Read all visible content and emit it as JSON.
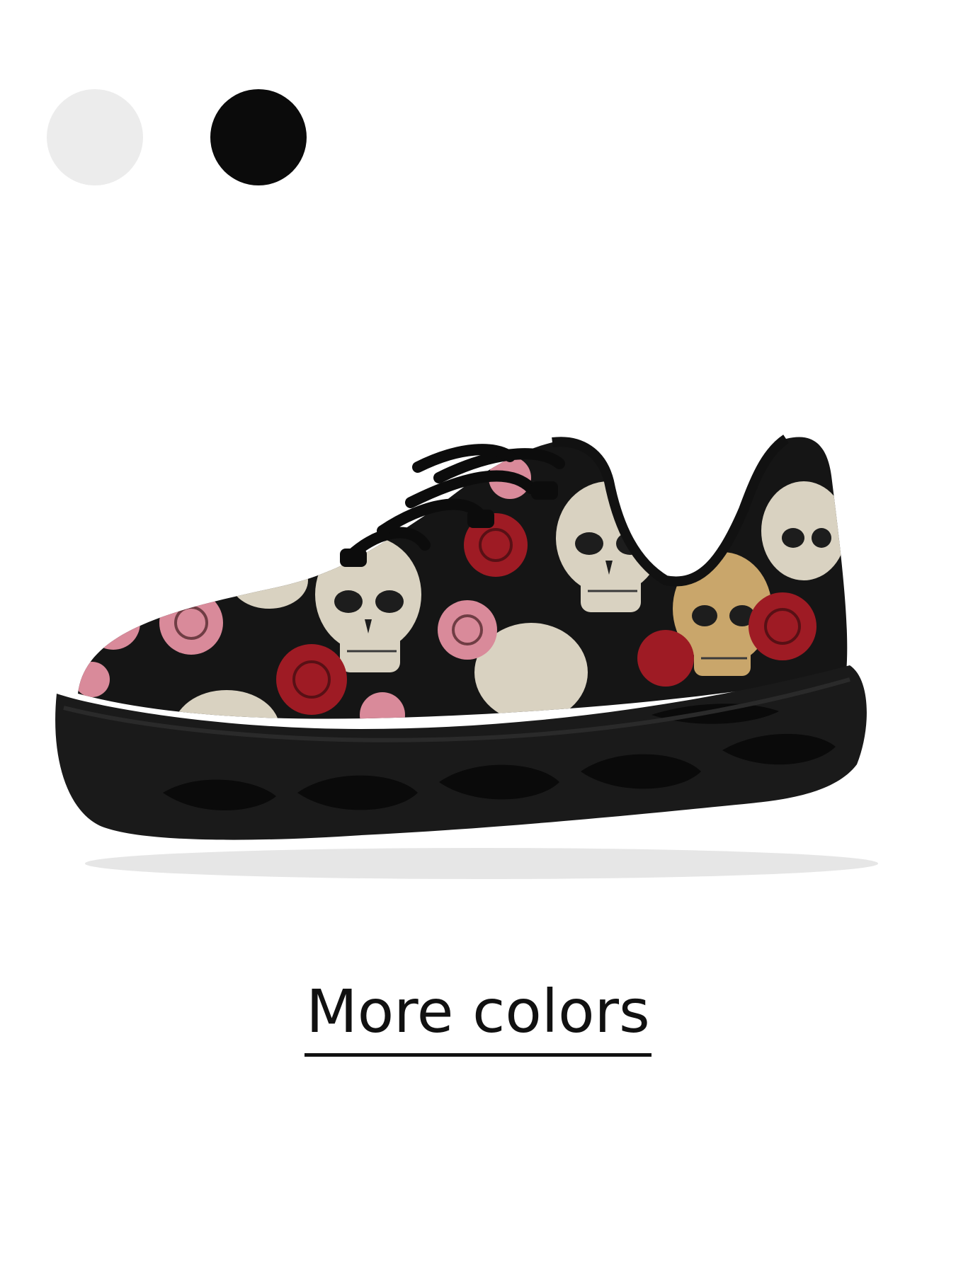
{
  "swatches": [
    {
      "name": "white",
      "color": "#ececec"
    },
    {
      "name": "black",
      "color": "#0b0b0b"
    }
  ],
  "product": {
    "image_icon": "sneaker-skull-roses-icon",
    "upper_color": "#151515",
    "sole_color": "#1a1a1a",
    "print_colors": {
      "skull": "#d9d2c1",
      "skull_tan": "#c9a66b",
      "rose_red": "#9e1b24",
      "rose_pink": "#d98a9a"
    }
  },
  "more_colors_link": "More colors"
}
